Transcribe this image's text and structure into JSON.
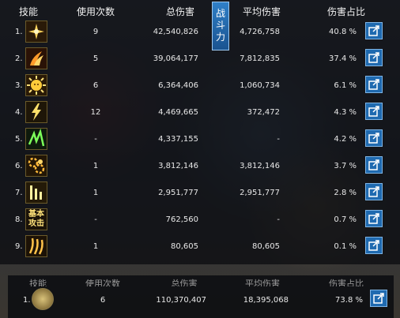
{
  "table": {
    "headers": {
      "skill": "技能",
      "uses": "使用次数",
      "total": "总伤害",
      "avg": "平均伤害",
      "pct": "伤害占比"
    },
    "tab_label": "战斗力",
    "rows": [
      {
        "idx": "1.",
        "icon": "cross-skill-icon",
        "uses": "9",
        "total": "42,540,826",
        "avg": "4,726,758",
        "pct": "40.8 %"
      },
      {
        "idx": "2.",
        "icon": "slash-wave-skill-icon",
        "uses": "5",
        "total": "39,064,177",
        "avg": "7,812,835",
        "pct": "37.4 %"
      },
      {
        "idx": "3.",
        "icon": "sun-face-skill-icon",
        "uses": "6",
        "total": "6,364,406",
        "avg": "1,060,734",
        "pct": "6.1 %"
      },
      {
        "idx": "4.",
        "icon": "lightning-skill-icon",
        "uses": "12",
        "total": "4,469,665",
        "avg": "372,472",
        "pct": "4.3 %"
      },
      {
        "idx": "5.",
        "icon": "green-rune-skill-icon",
        "uses": "-",
        "total": "4,337,155",
        "avg": "-",
        "pct": "4.2 %"
      },
      {
        "idx": "6.",
        "icon": "gear-orbs-skill-icon",
        "uses": "1",
        "total": "3,812,146",
        "avg": "3,812,146",
        "pct": "3.7 %"
      },
      {
        "idx": "7.",
        "icon": "rays-skill-icon",
        "uses": "1",
        "total": "2,951,777",
        "avg": "2,951,777",
        "pct": "2.8 %"
      },
      {
        "idx": "8.",
        "icon": "basic-attack-icon",
        "icon_text": "基本\n攻击",
        "uses": "-",
        "total": "762,560",
        "avg": "-",
        "pct": "0.7 %"
      },
      {
        "idx": "9.",
        "icon": "claw-skill-icon",
        "uses": "1",
        "total": "80,605",
        "avg": "80,605",
        "pct": "0.1 %"
      }
    ]
  },
  "summary": {
    "headers": {
      "skill": "技能",
      "uses": "使用次数",
      "total": "总伤害",
      "avg": "平均伤害",
      "pct": "伤害占比"
    },
    "row": {
      "idx": "1.",
      "icon": "character-portrait-icon",
      "uses": "6",
      "total": "110,370,407",
      "avg": "18,395,068",
      "pct": "73.8 %"
    }
  },
  "colors": {
    "share_button": "#1f6ab0",
    "tab": "#2f7fc7",
    "text": "#e8e8e8"
  }
}
